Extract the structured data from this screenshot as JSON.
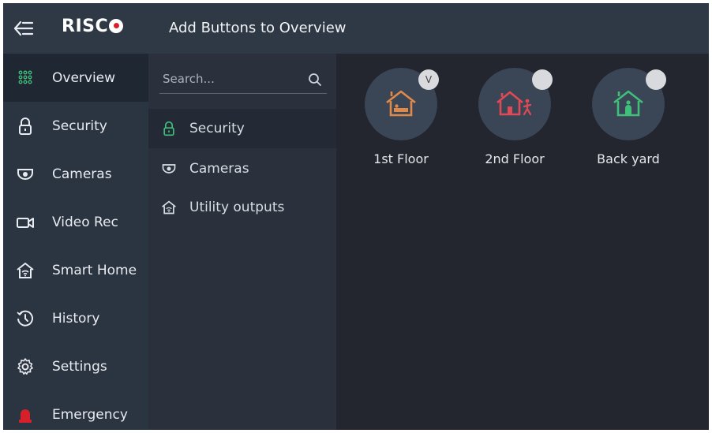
{
  "header": {
    "title": "Add Buttons to Overview"
  },
  "brand": {
    "logo_text": "RISC"
  },
  "sidebar": {
    "items": [
      {
        "label": "Overview",
        "icon": "keypad-grid-icon"
      },
      {
        "label": "Security",
        "icon": "padlock-icon"
      },
      {
        "label": "Cameras",
        "icon": "camera-icon"
      },
      {
        "label": "Video Rec",
        "icon": "video-camera-icon"
      },
      {
        "label": "Smart Home",
        "icon": "smart-home-icon"
      },
      {
        "label": "History",
        "icon": "history-clock-icon"
      },
      {
        "label": "Settings",
        "icon": "gear-icon"
      },
      {
        "label": "Emergency",
        "icon": "siren-icon"
      }
    ],
    "active_index": 0
  },
  "categories": {
    "search_placeholder": "Search...",
    "items": [
      {
        "label": "Security",
        "icon": "padlock-icon"
      },
      {
        "label": "Cameras",
        "icon": "camera-icon"
      },
      {
        "label": "Utility outputs",
        "icon": "smart-home-icon"
      }
    ],
    "active_index": 0
  },
  "tiles": [
    {
      "label": "1st Floor",
      "icon": "house-bed-icon",
      "selected": true,
      "check_text": "V",
      "color": "#e08a4a"
    },
    {
      "label": "2nd Floor",
      "icon": "house-person-icon",
      "selected": false,
      "check_text": "",
      "color": "#e04a56"
    },
    {
      "label": "Back yard",
      "icon": "house-person-icon",
      "selected": false,
      "check_text": "",
      "color": "#3fbf7a"
    }
  ],
  "colors": {
    "background": "#24262f",
    "sidebar": "#2b3441",
    "header": "#2f3946",
    "accent_green": "#3fbf7a",
    "logo_red": "#d6202c"
  }
}
